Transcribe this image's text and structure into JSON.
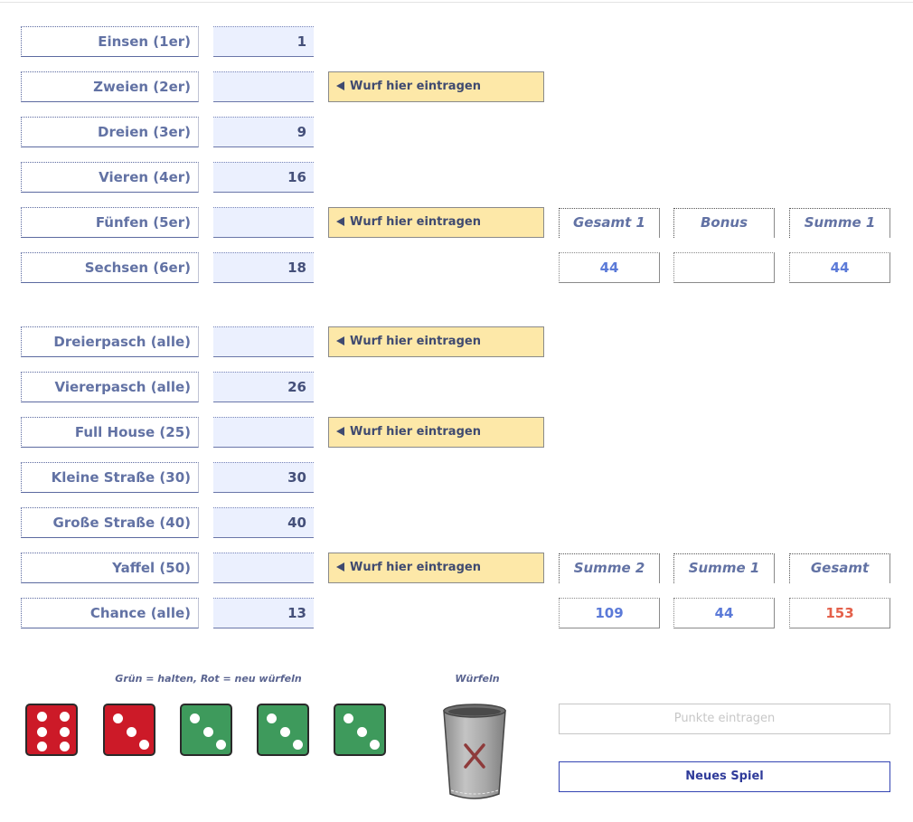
{
  "rows": [
    {
      "label": "Einsen (1er)",
      "score": "1",
      "enter": ""
    },
    {
      "label": "Zweien (2er)",
      "score": "",
      "enter": "Wurf hier eintragen"
    },
    {
      "label": "Dreien (3er)",
      "score": "9",
      "enter": ""
    },
    {
      "label": "Vieren (4er)",
      "score": "16",
      "enter": ""
    },
    {
      "label": "Fünfen (5er)",
      "score": "",
      "enter": "Wurf hier eintragen"
    },
    {
      "label": "Sechsen (6er)",
      "score": "18",
      "enter": ""
    },
    {
      "label": "Dreierpasch (alle)",
      "score": "",
      "enter": "Wurf hier eintragen"
    },
    {
      "label": "Viererpasch (alle)",
      "score": "26",
      "enter": ""
    },
    {
      "label": "Full House (25)",
      "score": "",
      "enter": "Wurf hier eintragen"
    },
    {
      "label": "Kleine Straße (30)",
      "score": "30",
      "enter": ""
    },
    {
      "label": "Große Straße (40)",
      "score": "40",
      "enter": ""
    },
    {
      "label": "Yaffel (50)",
      "score": "",
      "enter": "Wurf hier eintragen"
    },
    {
      "label": "Chance (alle)",
      "score": "13",
      "enter": ""
    }
  ],
  "upper_totals": {
    "headers": [
      "Gesamt 1",
      "Bonus",
      "Summe 1"
    ],
    "values": [
      "44",
      "",
      "44"
    ]
  },
  "lower_totals": {
    "headers": [
      "Summe 2",
      "Summe 1",
      "Gesamt"
    ],
    "values": [
      "109",
      "44",
      "153"
    ]
  },
  "dice_caption": "Grün = halten, Rot = neu würfeln",
  "roll_caption": "Würfeln",
  "dice": [
    {
      "value": 6,
      "state": "red"
    },
    {
      "value": 3,
      "state": "red"
    },
    {
      "value": 3,
      "state": "green"
    },
    {
      "value": 3,
      "state": "green"
    },
    {
      "value": 3,
      "state": "green"
    }
  ],
  "buttons": {
    "enter_points": "Punkte eintragen",
    "new_game": "Neues Spiel"
  },
  "colors": {
    "die_red": "#cc1a28",
    "die_green": "#3e9a5c",
    "total_red": "#e4604a",
    "accent_blue": "#5b7ad8"
  },
  "icons": {
    "enter_arrow": "triangle-left-icon",
    "cup": "dice-cup-icon",
    "cup_mark": "x-mark-icon"
  }
}
